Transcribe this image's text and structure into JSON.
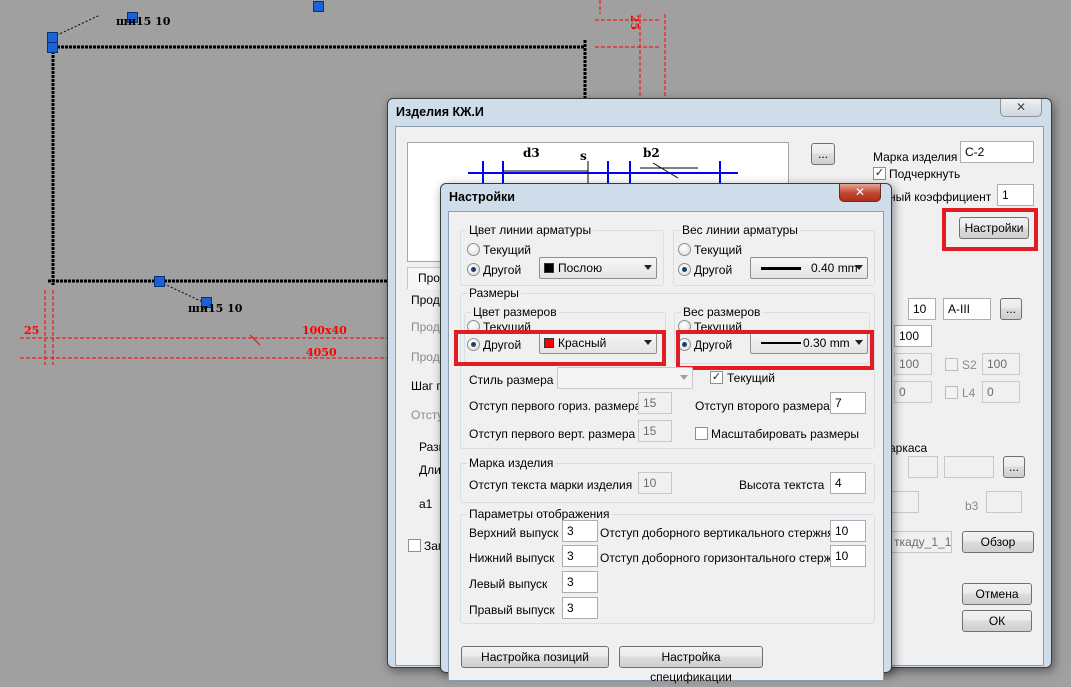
{
  "cad": {
    "labels": {
      "top_mark": "ши15 10",
      "bottom_mark": "ши15 10",
      "dim_25_left": "25",
      "dim_100x40": "100x40",
      "dim_4050": "4050",
      "dim_25_top": "25"
    }
  },
  "main_dialog": {
    "title": "Изделия КЖ.И",
    "close": "✕",
    "browse_button": "...",
    "mark_label": "Марка изделия",
    "mark_value": "С-2",
    "underline_label": "Подчеркнуть",
    "coef_label": "ный коэффициент",
    "coef_value": "1",
    "settings_button": "Настройки",
    "preview_labels": {
      "d3": "d3",
      "s": "s",
      "b2": "b2"
    },
    "left_rows": [
      "Прод",
      "Прод",
      "Прод",
      "Прод",
      "Шаг п",
      "Отсту"
    ],
    "group_size_label": "Разм",
    "length_label": "Длин",
    "a1_label": "a1",
    "save_label": "Запи",
    "right_values": {
      "v10": "10",
      "grade": "A-III",
      "v100_a": "100",
      "v100_b": "100",
      "s2_label": "S2",
      "v100_c": "100",
      "v0_a": "0",
      "l4_label": "L4",
      "v0_b": "0",
      "frame_label": "аркаса",
      "b3_label": "b3",
      "file_value": "ткаду_1_1"
    },
    "browse2_button": "...",
    "browse3_button": "...",
    "overview_button": "Обзор",
    "cancel_button": "Отмена",
    "ok_button": "ОК"
  },
  "settings_dialog": {
    "title": "Настройки",
    "close": "✕",
    "rebar_color": {
      "label": "Цвет линии арматуры",
      "current": "Текущий",
      "other": "Другой",
      "selected": "other",
      "combo": "Послою",
      "swatch": "#000000"
    },
    "rebar_weight": {
      "label": "Вес линии арматуры",
      "current": "Текущий",
      "other": "Другой",
      "selected": "other",
      "combo": "0.40 mm"
    },
    "dimensions": {
      "label": "Размеры",
      "color_label": "Цвет размеров",
      "color_current": "Текущий",
      "color_other": "Другой",
      "color_combo": "Красный",
      "color_swatch": "#ff0000",
      "weight_label": "Вес размеров",
      "weight_current": "Текущий",
      "weight_other": "Другой",
      "weight_combo": "0.30 mm",
      "style_label": "Стиль размера",
      "style_current_label": "Текущий",
      "first_horiz_label": "Отступ первого гориз. размера",
      "first_horiz_value": "15",
      "second_label": "Отступ второго размера",
      "second_value": "7",
      "first_vert_label": "Отступ первого верт. размера",
      "first_vert_value": "15",
      "scale_label": "Масштабировать размеры"
    },
    "mark": {
      "label": "Марка изделия",
      "offset_label": "Отступ текста марки изделия",
      "offset_value": "10",
      "height_label": "Высота тектста",
      "height_value": "4"
    },
    "display": {
      "label": "Параметры отображения",
      "top_label": "Верхний выпуск",
      "top_value": "3",
      "bottom_label": "Нижний выпуск",
      "bottom_value": "3",
      "left_label": "Левый выпуск",
      "left_value": "3",
      "right_label": "Правый выпуск",
      "right_value": "3",
      "extra_vert_label": "Отступ доборного вертикального стержня",
      "extra_vert_value": "10",
      "extra_horiz_label": "Отступ доборного горизонтального стержня",
      "extra_horiz_value": "10"
    },
    "positions_button": "Настройка позиций",
    "spec_button": "Настройка спецификации"
  },
  "colors": {
    "highlight": "#e31b23",
    "cad_background": "#a0a0a0",
    "dimension": "#ff0000",
    "grip": "#1a63d6"
  }
}
